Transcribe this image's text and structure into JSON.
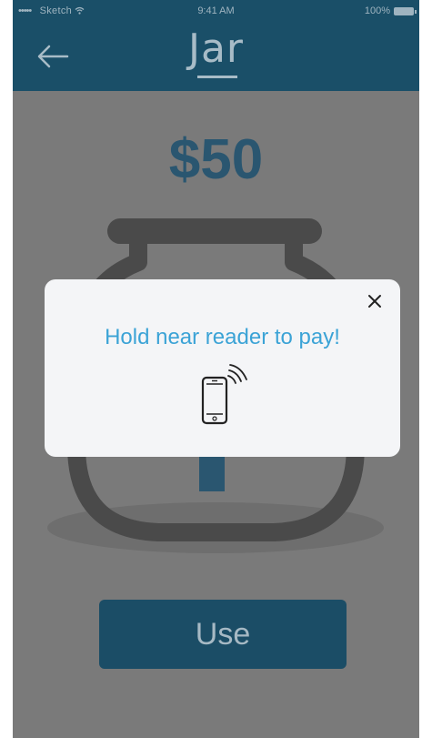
{
  "status_bar": {
    "signal": "•••••",
    "carrier": "Sketch",
    "time": "9:41 AM",
    "battery": "100%"
  },
  "navbar": {
    "brand": "Jar",
    "back_icon": "back-arrow-icon"
  },
  "main": {
    "amount": "$50",
    "use_button": "Use"
  },
  "modal": {
    "message": "Hold near reader to pay!",
    "close_icon": "close-icon",
    "phone_icon": "nfc-phone-icon"
  },
  "colors": {
    "accent": "#1a4f68",
    "modal_text": "#3ba3d6",
    "overlay": "#7a7a7a",
    "amount": "#2a5670"
  }
}
